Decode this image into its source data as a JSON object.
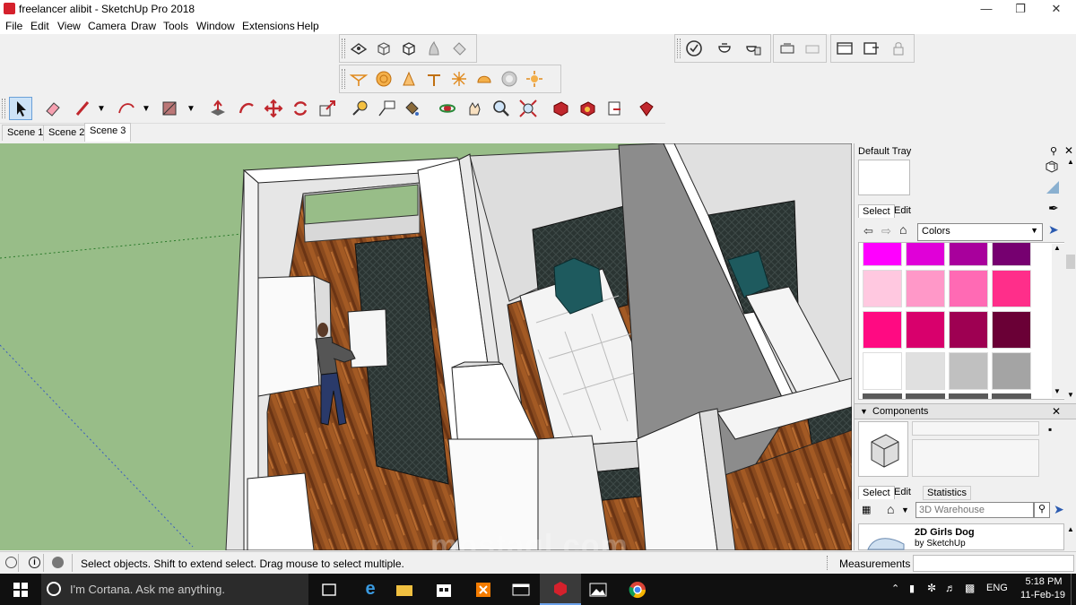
{
  "window": {
    "title": "freelancer alibit - SketchUp Pro 2018"
  },
  "menu": [
    "File",
    "Edit",
    "View",
    "Camera",
    "Draw",
    "Tools",
    "Window",
    "Extensions",
    "Help"
  ],
  "scenes": [
    "Scene 1",
    "Scene 2",
    "Scene 3"
  ],
  "active_scene": "Scene 3",
  "tray": {
    "title": "Default Tray",
    "materials": {
      "tabs": [
        "Select",
        "Edit"
      ],
      "library": "Colors"
    },
    "components": {
      "title": "Components",
      "tabs": [
        "Select",
        "Edit",
        "Statistics"
      ],
      "search_placeholder": "3D Warehouse",
      "result": {
        "name": "2D Girls Dog",
        "author": "by SketchUp"
      }
    }
  },
  "swatches": [
    "#ff00ff",
    "#e000d8",
    "#a8009c",
    "#760070",
    "#ffc8e0",
    "#ff98c8",
    "#ff6ab4",
    "#ff2e8a",
    "#ff0a82",
    "#d8006c",
    "#9e0052",
    "#6a0036",
    "#ffffff",
    "#e0e0e0",
    "#c0c0c0",
    "#a4a4a4"
  ],
  "status": {
    "hint": "Select objects. Shift to extend select. Drag mouse to select multiple.",
    "measurements_label": "Measurements"
  },
  "taskbar": {
    "search_placeholder": "I'm Cortana. Ask me anything.",
    "language": "ENG",
    "time": "5:18 PM",
    "date": "11-Feb-19"
  },
  "watermark": "mostaql.com"
}
